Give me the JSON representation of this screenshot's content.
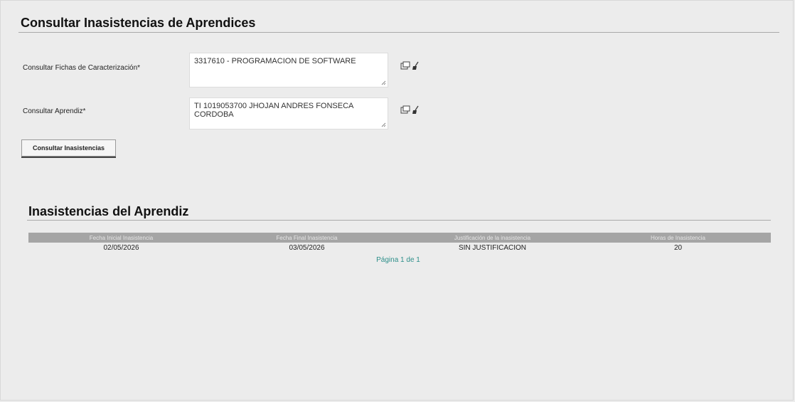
{
  "page": {
    "title": "Consultar Inasistencias de Aprendices"
  },
  "form": {
    "fichas": {
      "label": "Consultar Fichas de Caracterización*",
      "value": "3317610 - PROGRAMACION DE SOFTWARE"
    },
    "aprendiz": {
      "label": "Consultar Aprendiz*",
      "value": "TI 1019053700 JHOJAN ANDRES FONSECA CORDOBA"
    },
    "submit_label": "Consultar Inasistencias",
    "icons": [
      "search-popup-icon",
      "clear-brush-icon"
    ]
  },
  "results": {
    "title": "Inasistencias del Aprendiz",
    "columns": [
      "Fecha Inicial Inasistencia",
      "Fecha Final Inasistencia",
      "Justificación de la inasistencia",
      "Horas de Inasistencia"
    ],
    "rows": [
      [
        "02/05/2026",
        "03/05/2026",
        "SIN JUSTIFICACION",
        "20"
      ]
    ],
    "pager": "Página 1 de 1"
  },
  "colors": {
    "background": "#ececec",
    "header_bg": "#a5a5a5",
    "pager_link": "#2e8f8a"
  }
}
